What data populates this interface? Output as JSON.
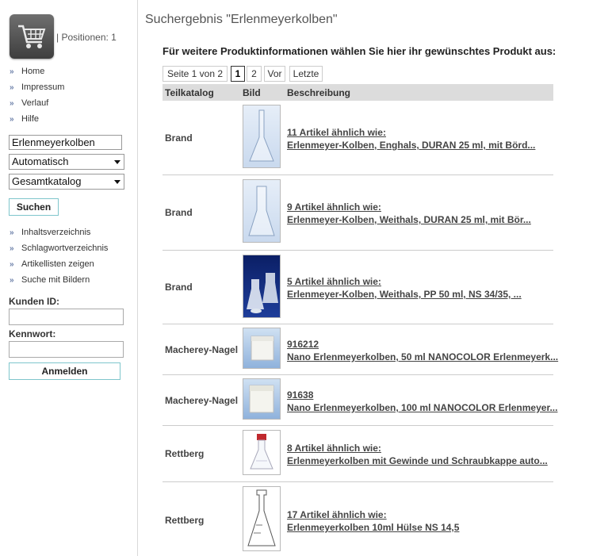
{
  "sidebar": {
    "positions": "| Positionen: 1",
    "nav_top": [
      "Home",
      "Impressum",
      "Verlauf",
      "Hilfe"
    ],
    "search_value": "Erlenmeyerkolben",
    "mode_select": "Automatisch",
    "catalog_select": "Gesamtkatalog",
    "search_button": "Suchen",
    "nav_bottom": [
      "Inhaltsverzeichnis",
      "Schlagwortverzeichnis",
      "Artikellisten zeigen",
      "Suche mit Bildern"
    ],
    "customer_id_label": "Kunden ID:",
    "password_label": "Kennwort:",
    "login_button": "Anmelden"
  },
  "main": {
    "title": "Suchergebnis \"Erlenmeyerkolben\"",
    "subtitle": "Für weitere Produktinformationen wählen Sie hier ihr gewünschtes Produkt aus:",
    "pager": {
      "page_info": "Seite 1 von 2",
      "page1": "1",
      "page2": "2",
      "prev": "Vor",
      "last": "Letzte"
    },
    "headers": {
      "catalog": "Teilkatalog",
      "image": "Bild",
      "description": "Beschreibung"
    },
    "rows": [
      {
        "catalog": "Brand",
        "line1": "11 Artikel ähnlich wie:",
        "line2": "Erlenmeyer-Kolben, Enghals, DURAN 25 ml, mit Börd..."
      },
      {
        "catalog": "Brand",
        "line1": "9 Artikel ähnlich wie:",
        "line2": "Erlenmeyer-Kolben, Weithals, DURAN 25 ml, mit Bör..."
      },
      {
        "catalog": "Brand",
        "line1": "5 Artikel ähnlich wie:",
        "line2": "Erlenmeyer-Kolben, Weithals, PP 50 ml, NS 34/35, ..."
      },
      {
        "catalog": "Macherey-Nagel",
        "line1": "916212",
        "line2": "Nano Erlenmeyerkolben, 50 ml NANOCOLOR Erlenmeyerk..."
      },
      {
        "catalog": "Macherey-Nagel",
        "line1": "91638",
        "line2": "Nano Erlenmeyerkolben, 100 ml NANOCOLOR Erlenmeyer..."
      },
      {
        "catalog": "Rettberg",
        "line1": "8 Artikel ähnlich wie:",
        "line2": "Erlenmeyerkolben mit Gewinde und Schraubkappe auto..."
      },
      {
        "catalog": "Rettberg",
        "line1": "17 Artikel ähnlich wie:",
        "line2": "Erlenmeyerkolben 10ml Hülse NS 14,5"
      }
    ]
  }
}
